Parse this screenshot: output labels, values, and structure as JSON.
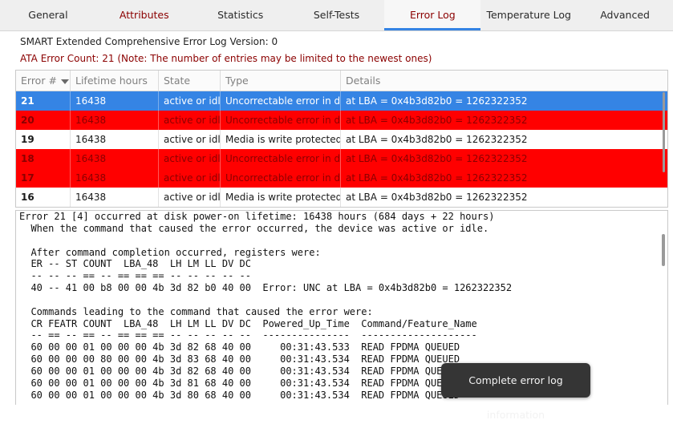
{
  "tabs": [
    {
      "label": "General",
      "warn": false,
      "active": false
    },
    {
      "label": "Attributes",
      "warn": true,
      "active": false
    },
    {
      "label": "Statistics",
      "warn": false,
      "active": false
    },
    {
      "label": "Self-Tests",
      "warn": false,
      "active": false
    },
    {
      "label": "Error Log",
      "warn": true,
      "active": true
    },
    {
      "label": "Temperature Log",
      "warn": false,
      "active": false
    },
    {
      "label": "Advanced",
      "warn": false,
      "active": false
    }
  ],
  "info": {
    "version_line": "SMART Extended Comprehensive Error Log Version: 0",
    "count_line": "ATA Error Count: 21 (Note: The number of entries may be limited to the newest ones)"
  },
  "table": {
    "headers": [
      "Error #",
      "Lifetime hours",
      "State",
      "Type",
      "Details"
    ],
    "rows": [
      {
        "num": "21",
        "hours": "16438",
        "state": "active or idle",
        "type": "Uncorrectable error in data",
        "details": "at LBA = 0x4b3d82b0 = 1262322352",
        "style": "sel"
      },
      {
        "num": "20",
        "hours": "16438",
        "state": "active or idle",
        "type": "Uncorrectable error in data",
        "details": "at LBA = 0x4b3d82b0 = 1262322352",
        "style": "err"
      },
      {
        "num": "19",
        "hours": "16438",
        "state": "active or idle",
        "type": "Media is write protected",
        "details": "at LBA = 0x4b3d82b0 = 1262322352",
        "style": "norm"
      },
      {
        "num": "18",
        "hours": "16438",
        "state": "active or idle",
        "type": "Uncorrectable error in data",
        "details": "at LBA = 0x4b3d82b0 = 1262322352",
        "style": "err"
      },
      {
        "num": "17",
        "hours": "16438",
        "state": "active or idle",
        "type": "Uncorrectable error in data",
        "details": "at LBA = 0x4b3d82b0 = 1262322352",
        "style": "err"
      },
      {
        "num": "16",
        "hours": "16438",
        "state": "active or idle",
        "type": "Media is write protected",
        "details": "at LBA = 0x4b3d82b0 = 1262322352",
        "style": "norm"
      }
    ]
  },
  "log_lines": [
    "Error 21 [4] occurred at disk power-on lifetime: 16438 hours (684 days + 22 hours)",
    "  When the command that caused the error occurred, the device was active or idle.",
    "",
    "  After command completion occurred, registers were:",
    "  ER -- ST COUNT  LBA_48  LH LM LL DV DC",
    "  -- -- -- == -- == == == -- -- -- -- --",
    "  40 -- 41 00 b8 00 00 4b 3d 82 b0 40 00  Error: UNC at LBA = 0x4b3d82b0 = 1262322352",
    "",
    "  Commands leading to the command that caused the error were:",
    "  CR FEATR COUNT  LBA_48  LH LM LL DV DC  Powered_Up_Time  Command/Feature_Name",
    "  -- == -- == -- == == == -- -- -- -- --  ---------------  --------------------",
    "  60 00 00 01 00 00 00 4b 3d 82 68 40 00     00:31:43.533  READ FPDMA QUEUED",
    "  60 00 00 00 80 00 00 4b 3d 83 68 40 00     00:31:43.534  READ FPDMA QUEUED",
    "  60 00 00 01 00 00 00 4b 3d 82 68 40 00     00:31:43.534  READ FPDMA QUEUED",
    "  60 00 00 01 00 00 00 4b 3d 81 68 40 00     00:31:43.534  READ FPDMA QUEUED",
    "  60 00 00 01 00 00 00 4b 3d 80 68 40 00     00:31:43.534  READ FPDMA QUEUED"
  ],
  "tooltip": "Complete error log information",
  "colors": {
    "accent": "#3584e4",
    "error_row": "#ff0000",
    "warn_text": "#8b0000"
  }
}
